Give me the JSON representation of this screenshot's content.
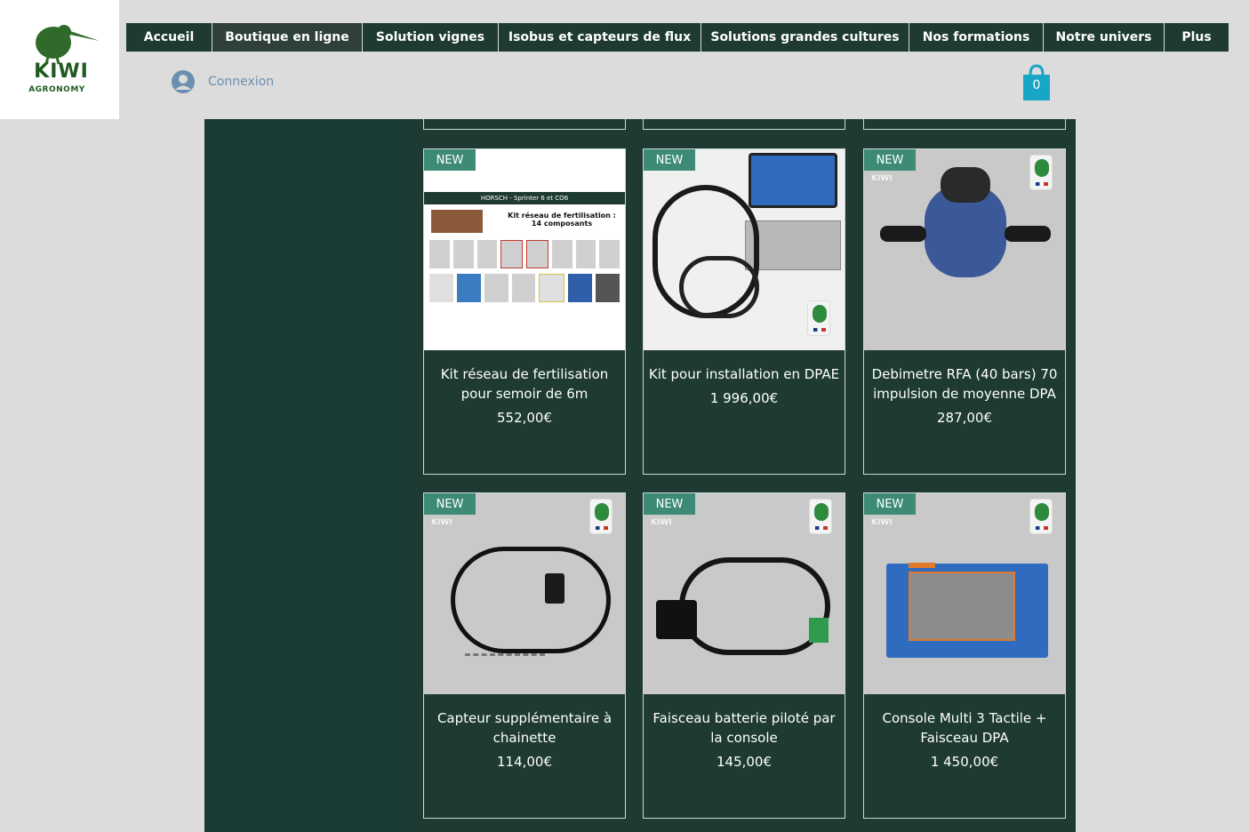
{
  "brand": {
    "name": "KIWI",
    "sub": "AGRONOMY"
  },
  "nav": [
    {
      "label": "Accueil"
    },
    {
      "label": "Boutique en ligne"
    },
    {
      "label": "Solution vignes"
    },
    {
      "label": "Isobus et capteurs de flux"
    },
    {
      "label": "Solutions grandes cultures"
    },
    {
      "label": "Nos formations"
    },
    {
      "label": "Notre univers"
    },
    {
      "label": "Plus"
    }
  ],
  "login": {
    "label": "Connexion"
  },
  "cart": {
    "count": "0"
  },
  "colors": {
    "nav_bg": "#1e3a33",
    "badge": "#3d8b76",
    "cart": "#18a6c7",
    "login": "#6a8fb0"
  },
  "products": [
    {
      "badge": "NEW",
      "title": "Kit réseau de fertilisation pour semoir de 6m",
      "price": "552,00€",
      "image_heading": "HORSCH - Sprinter 6 et CO6",
      "image_caption": "Kit réseau de fertilisation : 14 composants"
    },
    {
      "badge": "NEW",
      "title": "Kit pour installation en DPAE",
      "price": "1 996,00€"
    },
    {
      "badge": "NEW",
      "title": "Debimetre RFA (40 bars) 70 impulsion de moyenne DPA",
      "price": "287,00€"
    },
    {
      "badge": "NEW",
      "title": "Capteur supplémentaire à chainette",
      "price": "114,00€"
    },
    {
      "badge": "NEW",
      "title": "Faisceau batterie piloté par la console",
      "price": "145,00€"
    },
    {
      "badge": "NEW",
      "title": "Console Multi 3 Tactile + Faisceau DPA",
      "price": "1 450,00€"
    }
  ]
}
